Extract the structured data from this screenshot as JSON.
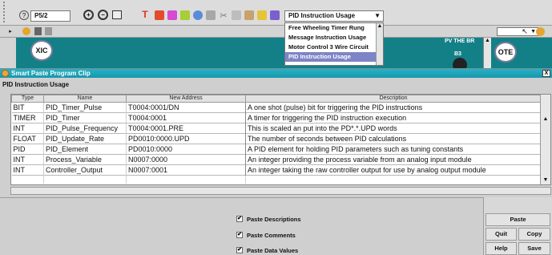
{
  "toolbar": {
    "program_dropdown": "P5/2",
    "usage_dropdown": "PID Instruction Usage",
    "usage_options": [
      "Free Wheeling Timer Rung",
      "Message Instruction Usage",
      "Motor Control 3 Wire Circuit",
      "PID Instruction Usage"
    ],
    "selected_option_index": 3
  },
  "ladder": {
    "xic_label": "XIC",
    "ote_label": "OTE",
    "right_label": "PV THE BR",
    "b3_label": "B3"
  },
  "dialog": {
    "title": "Smart Paste Program Clip",
    "subheader": "PID Instruction Usage",
    "close_glyph": "X",
    "columns": [
      "Type",
      "Name",
      "New Address",
      "Description"
    ],
    "rows": [
      {
        "type": "BIT",
        "name": "PID_Timer_Pulse",
        "address": "T0004:0001/DN",
        "description": "A one shot (pulse) bit for triggering the PID instructions"
      },
      {
        "type": "TIMER",
        "name": "PID_Timer",
        "address": "T0004:0001",
        "description": "A timer for triggering the PID instruction execution"
      },
      {
        "type": "INT",
        "name": "PID_Pulse_Frequency",
        "address": "T0004:0001.PRE",
        "description": "This is scaled an put into the PD*.*.UPD words"
      },
      {
        "type": "FLOAT",
        "name": "PID_Update_Rate",
        "address": "PD0010:0000.UPD",
        "description": "The number of seconds between PID calculations"
      },
      {
        "type": "PID",
        "name": "PID_Element",
        "address": "PD0010:0000",
        "description": "A PID element for holding PID parameters such as tuning constants"
      },
      {
        "type": "INT",
        "name": "Process_Variable",
        "address": "N0007:0000",
        "description": "An integer providing the process variable from an analog input module"
      },
      {
        "type": "INT",
        "name": "Controller_Output",
        "address": "N0007:0001",
        "description": "An integer taking the raw controller output for use by analog output module"
      }
    ],
    "options": [
      {
        "label": "Paste Descriptions",
        "checked": true
      },
      {
        "label": "Paste Comments",
        "checked": true
      },
      {
        "label": "Paste Data Values",
        "checked": true
      }
    ],
    "check_glyph": "✔",
    "buttons": {
      "paste": "Paste",
      "quit": "Quit",
      "copy": "Copy",
      "help": "Help",
      "save": "Save"
    }
  },
  "colors": {
    "ladder_bg": "#138087",
    "titlebar": "#1ea6bb",
    "selected_option": "#7d85c7"
  }
}
